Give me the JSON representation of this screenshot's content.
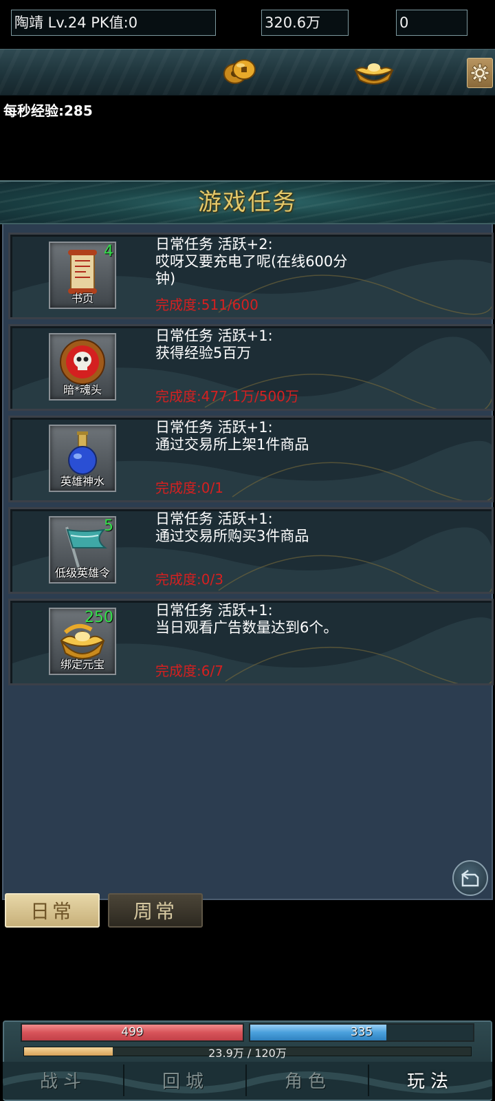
{
  "player": {
    "info": "陶靖  Lv.24 PK值:0"
  },
  "currency": {
    "gold": "320.6万",
    "ingot": "0"
  },
  "exp_rate": "每秒经验:285",
  "panel": {
    "title": "游戏任务"
  },
  "tasks": [
    {
      "item_name": "书页",
      "item_count": "4",
      "text": "日常任务 活跃+2:\n哎呀又要充电了呢(在线600分钟)",
      "progress": "完成度:511/600"
    },
    {
      "item_name": "暗*魂头",
      "item_count": "",
      "text": "日常任务 活跃+1:\n获得经验5百万",
      "progress": "完成度:477.1万/500万"
    },
    {
      "item_name": "英雄神水",
      "item_count": "",
      "text": "日常任务 活跃+1:\n通过交易所上架1件商品",
      "progress": "完成度:0/1"
    },
    {
      "item_name": "低级英雄令",
      "item_count": "5",
      "text": "日常任务 活跃+1:\n通过交易所购买3件商品",
      "progress": "完成度:0/3"
    },
    {
      "item_name": "绑定元宝",
      "item_count": "250",
      "text": "日常任务 活跃+1:\n当日观看广告数量达到6个。",
      "progress": "完成度:6/7"
    }
  ],
  "tabs": {
    "daily": "日常",
    "weekly": "周常"
  },
  "hud": {
    "hp": "499",
    "hp_fill": 1.0,
    "mp": "335",
    "mp_fill": 0.61,
    "exp": "23.9万 / 120万",
    "exp_fraction": 0.199
  },
  "nav": {
    "battle": "战斗",
    "return_city": "回城",
    "character": "角色",
    "gameplay": "玩法"
  },
  "colors": {
    "progress_red": "#d52020",
    "count_green": "#33e04a",
    "title_gold": "#e3c86a"
  },
  "icons": {
    "settings": "gear-icon",
    "coins": "coins-icon",
    "ingot": "gold-ingot-icon",
    "return": "return-arrow-icon"
  }
}
